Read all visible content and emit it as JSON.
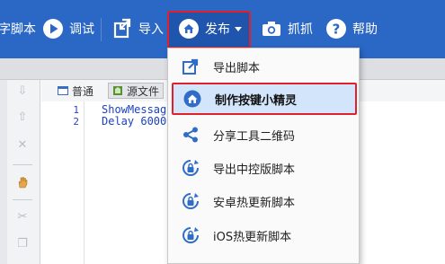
{
  "toolbar": {
    "script_label": "脚本",
    "script_partial": "字",
    "debug_label": "调试",
    "import_label": "导入",
    "publish_label": "发布",
    "capture_label": "抓抓",
    "help_label": "帮助"
  },
  "editor": {
    "tabs": [
      {
        "label": "普通",
        "icon": "window-icon"
      },
      {
        "label": "源文件",
        "icon": "source-file-icon"
      }
    ],
    "lines": [
      {
        "no": "1",
        "code": "ShowMessage"
      },
      {
        "no": "2",
        "code": "Delay 6000"
      }
    ]
  },
  "publish_menu": {
    "items": [
      {
        "label": "导出脚本",
        "icon": "export-icon"
      },
      {
        "label": "制作按键小精灵",
        "icon": "house-icon",
        "highlighted": true
      },
      {
        "label": "分享工具二维码",
        "icon": "share-icon"
      },
      {
        "label": "导出中控版脚本",
        "icon": "lock-refresh-icon"
      },
      {
        "label": "安卓热更新脚本",
        "icon": "lock-refresh-icon"
      },
      {
        "label": "iOS热更新脚本",
        "icon": "lock-refresh-icon"
      }
    ]
  },
  "colors": {
    "toolbar_bg": "#2b67c5",
    "highlight_bg": "#d3e5fa",
    "highlight_border": "#e0202a",
    "menu_icon": "#2f6dc8"
  }
}
